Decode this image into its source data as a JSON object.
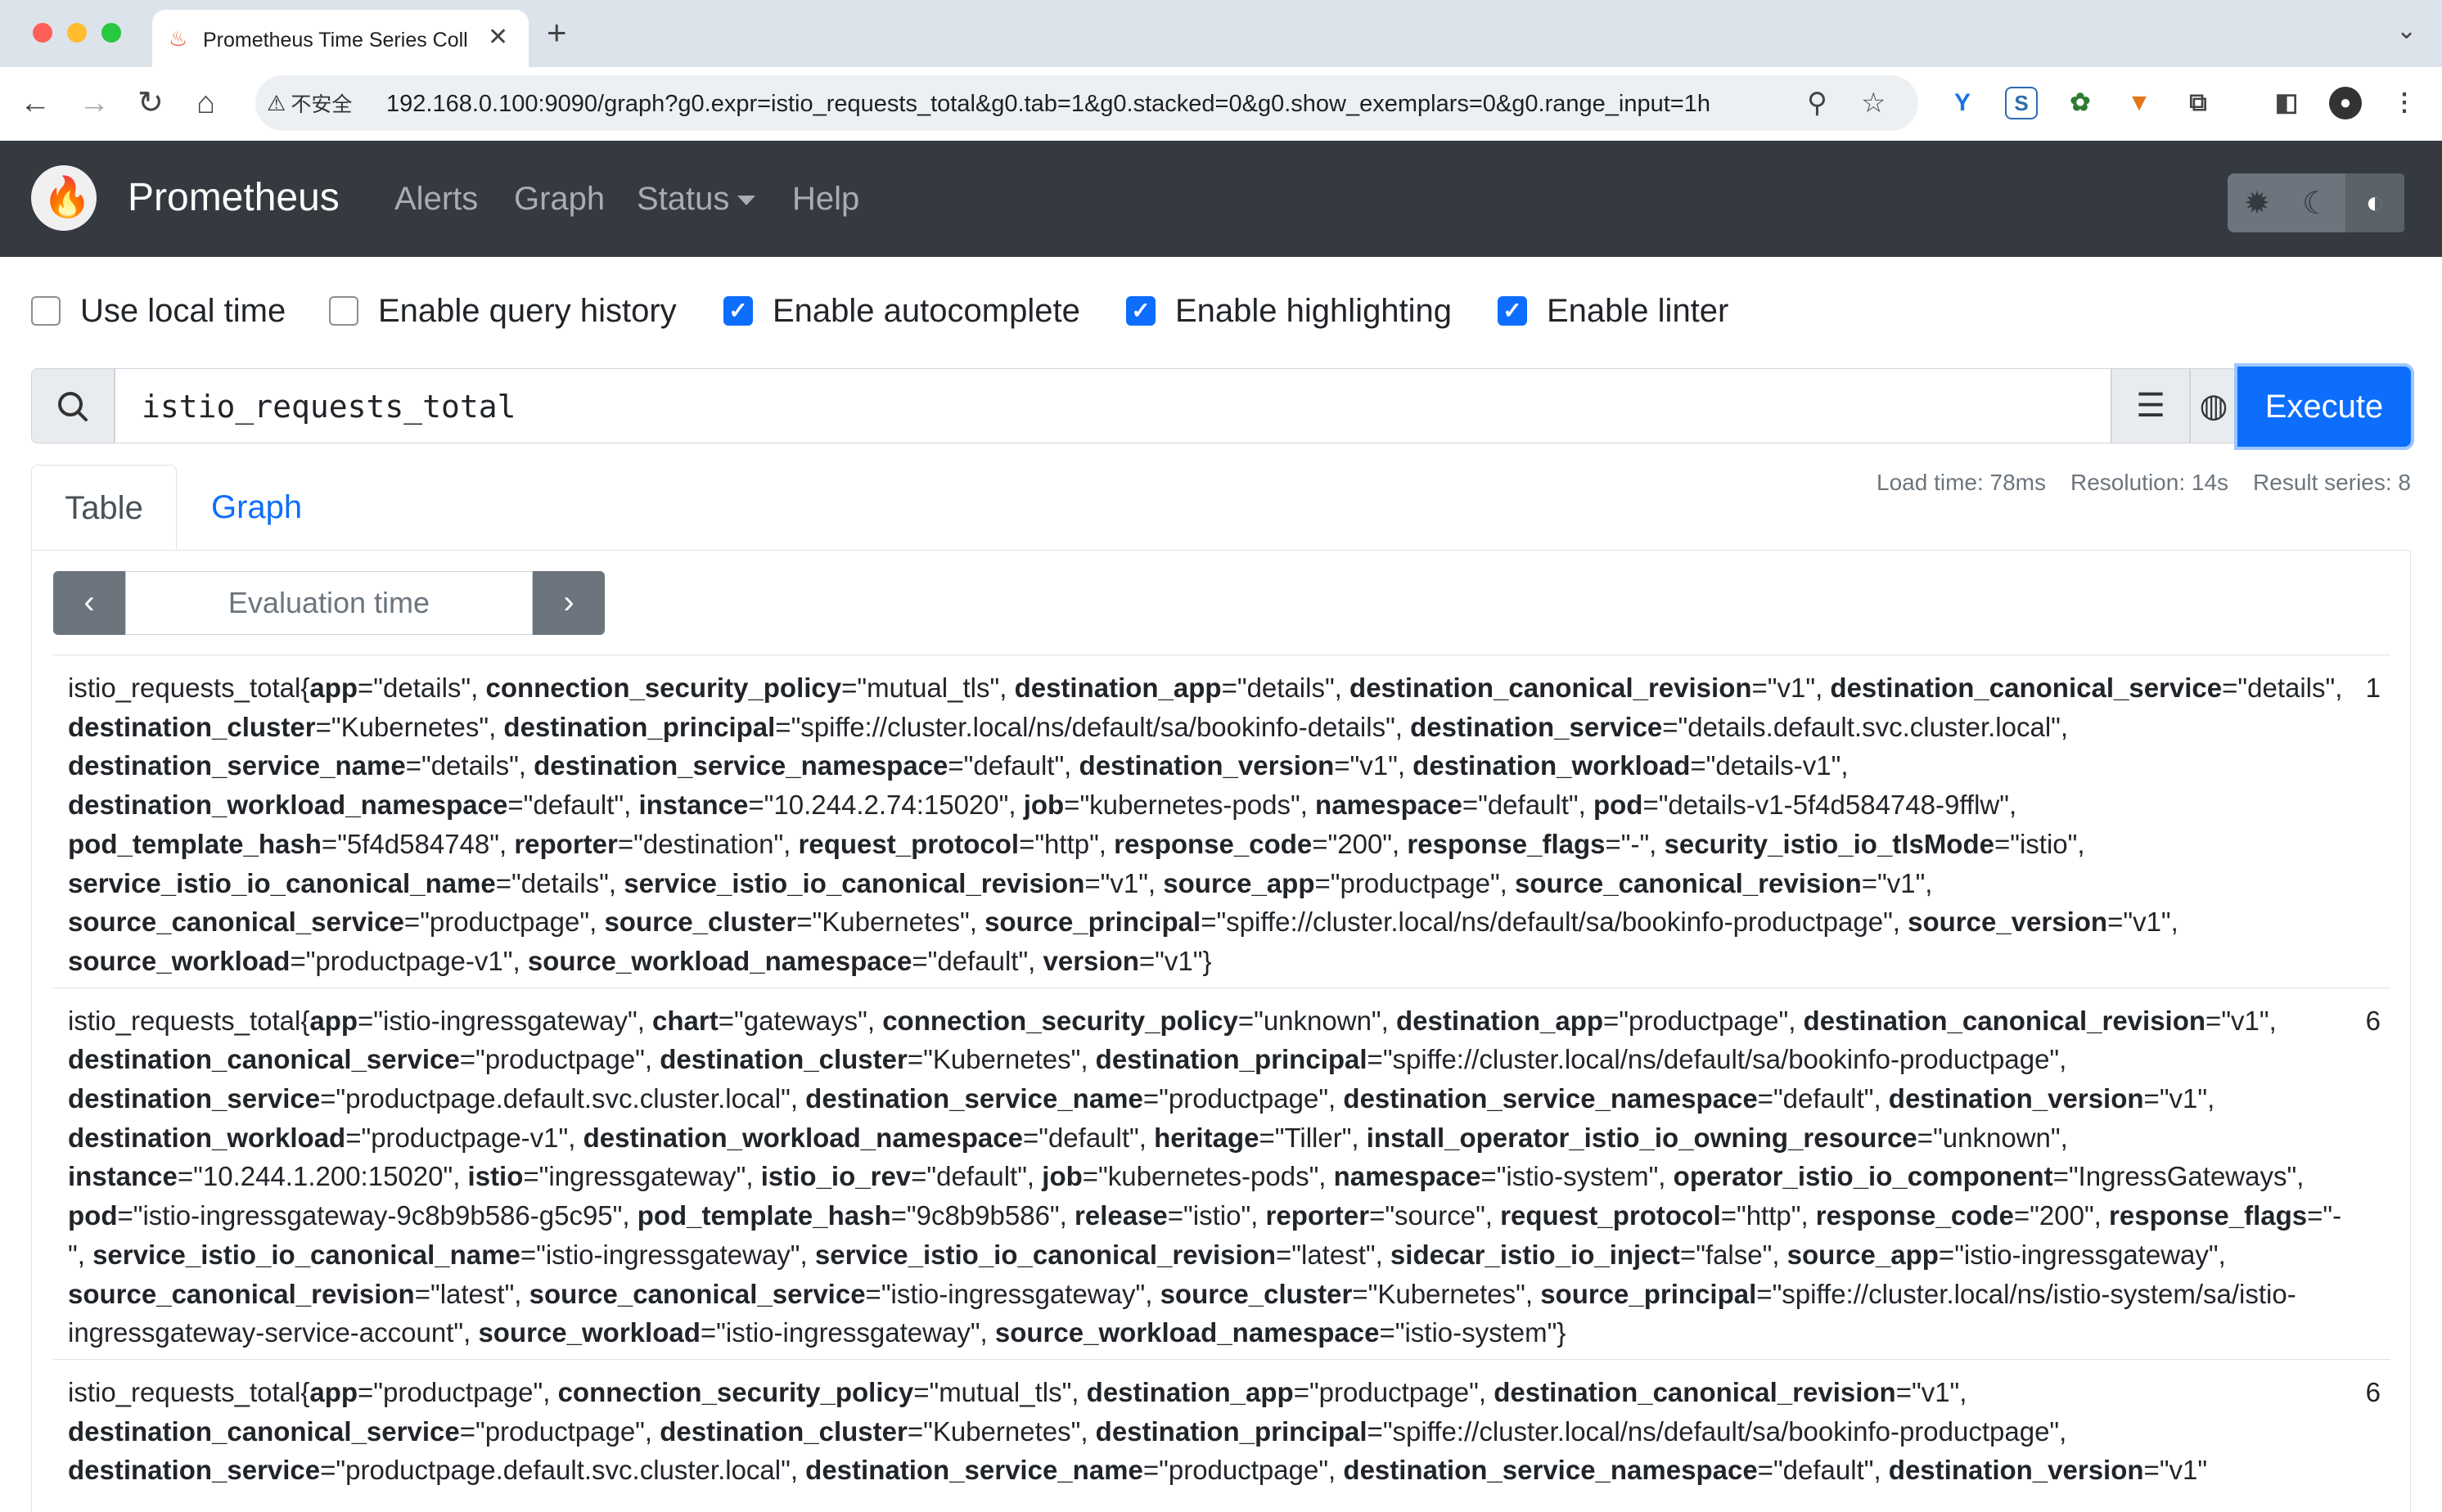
{
  "browser": {
    "tab_title": "Prometheus Time Series Coll",
    "security_label": "不安全",
    "url": "192.168.0.100:9090/graph?g0.expr=istio_requests_total&g0.tab=1&g0.stacked=0&g0.show_exemplars=0&g0.range_input=1h"
  },
  "navbar": {
    "brand": "Prometheus",
    "links": [
      "Alerts",
      "Graph",
      "Status",
      "Help"
    ]
  },
  "options": [
    {
      "label": "Use local time",
      "checked": false
    },
    {
      "label": "Enable query history",
      "checked": false
    },
    {
      "label": "Enable autocomplete",
      "checked": true
    },
    {
      "label": "Enable highlighting",
      "checked": true
    },
    {
      "label": "Enable linter",
      "checked": true
    }
  ],
  "query": {
    "expression": "istio_requests_total",
    "execute_label": "Execute"
  },
  "tabs": {
    "table": "Table",
    "graph": "Graph"
  },
  "stats": {
    "load_time": "Load time: 78ms",
    "resolution": "Resolution: 14s",
    "result_series": "Result series: 8"
  },
  "eval": {
    "placeholder": "Evaluation time"
  },
  "metric": "istio_requests_total",
  "results": [
    {
      "value": "1",
      "labels": [
        [
          "app",
          "details"
        ],
        [
          "connection_security_policy",
          "mutual_tls"
        ],
        [
          "destination_app",
          "details"
        ],
        [
          "destination_canonical_revision",
          "v1"
        ],
        [
          "destination_canonical_service",
          "details"
        ],
        [
          "destination_cluster",
          "Kubernetes"
        ],
        [
          "destination_principal",
          "spiffe://cluster.local/ns/default/sa/bookinfo-details"
        ],
        [
          "destination_service",
          "details.default.svc.cluster.local"
        ],
        [
          "destination_service_name",
          "details"
        ],
        [
          "destination_service_namespace",
          "default"
        ],
        [
          "destination_version",
          "v1"
        ],
        [
          "destination_workload",
          "details-v1"
        ],
        [
          "destination_workload_namespace",
          "default"
        ],
        [
          "instance",
          "10.244.2.74:15020"
        ],
        [
          "job",
          "kubernetes-pods"
        ],
        [
          "namespace",
          "default"
        ],
        [
          "pod",
          "details-v1-5f4d584748-9fflw"
        ],
        [
          "pod_template_hash",
          "5f4d584748"
        ],
        [
          "reporter",
          "destination"
        ],
        [
          "request_protocol",
          "http"
        ],
        [
          "response_code",
          "200"
        ],
        [
          "response_flags",
          "-"
        ],
        [
          "security_istio_io_tlsMode",
          "istio"
        ],
        [
          "service_istio_io_canonical_name",
          "details"
        ],
        [
          "service_istio_io_canonical_revision",
          "v1"
        ],
        [
          "source_app",
          "productpage"
        ],
        [
          "source_canonical_revision",
          "v1"
        ],
        [
          "source_canonical_service",
          "productpage"
        ],
        [
          "source_cluster",
          "Kubernetes"
        ],
        [
          "source_principal",
          "spiffe://cluster.local/ns/default/sa/bookinfo-productpage"
        ],
        [
          "source_version",
          "v1"
        ],
        [
          "source_workload",
          "productpage-v1"
        ],
        [
          "source_workload_namespace",
          "default"
        ],
        [
          "version",
          "v1"
        ]
      ]
    },
    {
      "value": "6",
      "labels": [
        [
          "app",
          "istio-ingressgateway"
        ],
        [
          "chart",
          "gateways"
        ],
        [
          "connection_security_policy",
          "unknown"
        ],
        [
          "destination_app",
          "productpage"
        ],
        [
          "destination_canonical_revision",
          "v1"
        ],
        [
          "destination_canonical_service",
          "productpage"
        ],
        [
          "destination_cluster",
          "Kubernetes"
        ],
        [
          "destination_principal",
          "spiffe://cluster.local/ns/default/sa/bookinfo-productpage"
        ],
        [
          "destination_service",
          "productpage.default.svc.cluster.local"
        ],
        [
          "destination_service_name",
          "productpage"
        ],
        [
          "destination_service_namespace",
          "default"
        ],
        [
          "destination_version",
          "v1"
        ],
        [
          "destination_workload",
          "productpage-v1"
        ],
        [
          "destination_workload_namespace",
          "default"
        ],
        [
          "heritage",
          "Tiller"
        ],
        [
          "install_operator_istio_io_owning_resource",
          "unknown"
        ],
        [
          "instance",
          "10.244.1.200:15020"
        ],
        [
          "istio",
          "ingressgateway"
        ],
        [
          "istio_io_rev",
          "default"
        ],
        [
          "job",
          "kubernetes-pods"
        ],
        [
          "namespace",
          "istio-system"
        ],
        [
          "operator_istio_io_component",
          "IngressGateways"
        ],
        [
          "pod",
          "istio-ingressgateway-9c8b9b586-g5c95"
        ],
        [
          "pod_template_hash",
          "9c8b9b586"
        ],
        [
          "release",
          "istio"
        ],
        [
          "reporter",
          "source"
        ],
        [
          "request_protocol",
          "http"
        ],
        [
          "response_code",
          "200"
        ],
        [
          "response_flags",
          "-"
        ],
        [
          "service_istio_io_canonical_name",
          "istio-ingressgateway"
        ],
        [
          "service_istio_io_canonical_revision",
          "latest"
        ],
        [
          "sidecar_istio_io_inject",
          "false"
        ],
        [
          "source_app",
          "istio-ingressgateway"
        ],
        [
          "source_canonical_revision",
          "latest"
        ],
        [
          "source_canonical_service",
          "istio-ingressgateway"
        ],
        [
          "source_cluster",
          "Kubernetes"
        ],
        [
          "source_principal",
          "spiffe://cluster.local/ns/istio-system/sa/istio-ingressgateway-service-account"
        ],
        [
          "source_workload",
          "istio-ingressgateway"
        ],
        [
          "source_workload_namespace",
          "istio-system"
        ]
      ]
    },
    {
      "value": "6",
      "labels": [
        [
          "app",
          "productpage"
        ],
        [
          "connection_security_policy",
          "mutual_tls"
        ],
        [
          "destination_app",
          "productpage"
        ],
        [
          "destination_canonical_revision",
          "v1"
        ],
        [
          "destination_canonical_service",
          "productpage"
        ],
        [
          "destination_cluster",
          "Kubernetes"
        ],
        [
          "destination_principal",
          "spiffe://cluster.local/ns/default/sa/bookinfo-productpage"
        ],
        [
          "destination_service",
          "productpage.default.svc.cluster.local"
        ],
        [
          "destination_service_name",
          "productpage"
        ],
        [
          "destination_service_namespace",
          "default"
        ],
        [
          "destination_version",
          "v1"
        ]
      ]
    }
  ]
}
